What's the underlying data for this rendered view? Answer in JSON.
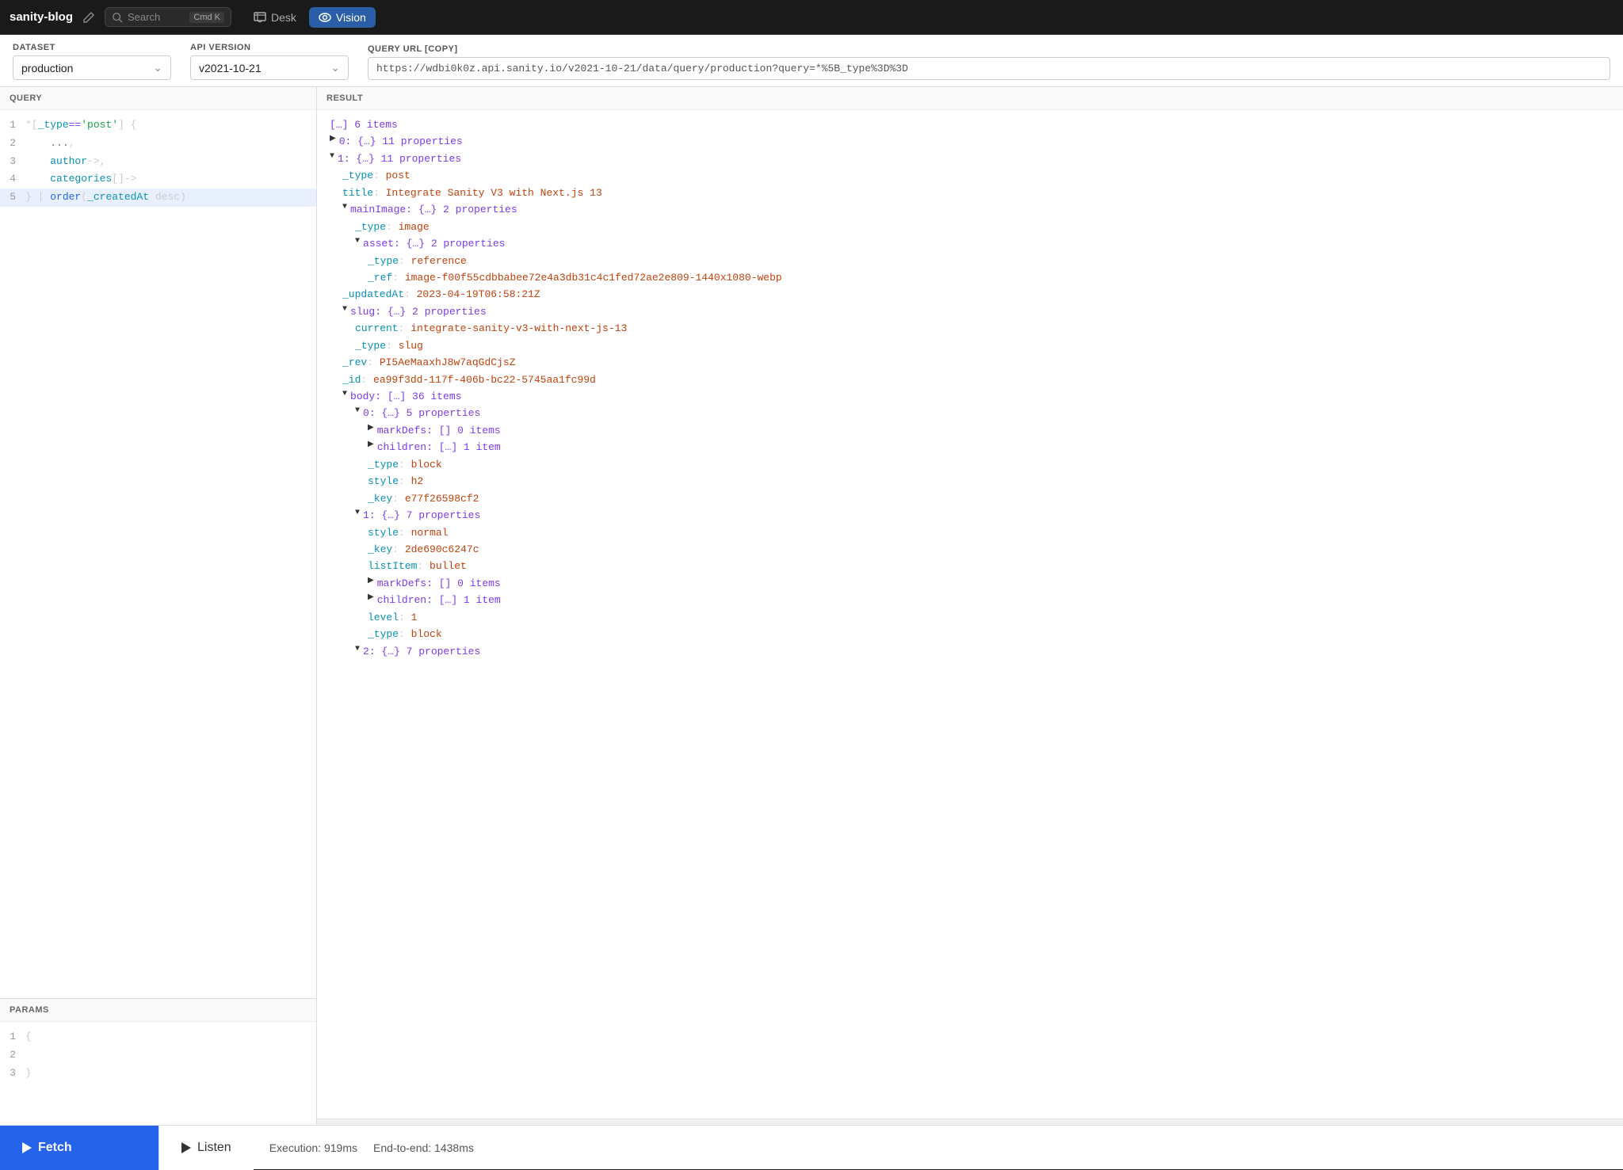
{
  "app": {
    "title": "sanity-blog",
    "search_placeholder": "Search",
    "search_shortcut": "Cmd K"
  },
  "nav": {
    "tabs": [
      {
        "id": "desk",
        "label": "Desk",
        "icon": "desk-icon",
        "active": false
      },
      {
        "id": "vision",
        "label": "Vision",
        "icon": "eye-icon",
        "active": true
      }
    ]
  },
  "controls": {
    "dataset_label": "DATASET",
    "dataset_value": "production",
    "api_version_label": "API VERSION",
    "api_version_value": "v2021-10-21",
    "query_url_label": "QUERY URL [COPY]",
    "query_url_value": "https://wdbi0k0z.api.sanity.io/v2021-10-21/data/query/production?query=*%5B_type%3D%3D"
  },
  "query": {
    "section_label": "QUERY",
    "lines": [
      {
        "num": 1,
        "content": "*[_type=='post'] {"
      },
      {
        "num": 2,
        "content": "    ...,"
      },
      {
        "num": 3,
        "content": "    author->,"
      },
      {
        "num": 4,
        "content": "    categories[]->"
      },
      {
        "num": 5,
        "content": "} | order(_createdAt desc)"
      }
    ]
  },
  "params": {
    "section_label": "PARAMS",
    "lines": [
      {
        "num": 1,
        "content": "{"
      },
      {
        "num": 2,
        "content": ""
      },
      {
        "num": 3,
        "content": "}"
      }
    ]
  },
  "result": {
    "section_label": "RESULT",
    "items": [
      {
        "indent": 0,
        "triangle": "",
        "text": "[…] 6 items",
        "color": "purple"
      },
      {
        "indent": 0,
        "triangle": "▶",
        "text": "0: {…} 11 properties",
        "color": "purple"
      },
      {
        "indent": 0,
        "triangle": "▼",
        "text": "1: {…} 11 properties",
        "color": "purple"
      },
      {
        "indent": 1,
        "triangle": "",
        "text": "_type: post",
        "color": "normal"
      },
      {
        "indent": 1,
        "triangle": "",
        "text": "title: Integrate Sanity V3 with Next.js 13",
        "color": "normal"
      },
      {
        "indent": 1,
        "triangle": "▼",
        "text": "mainImage: {…} 2 properties",
        "color": "purple"
      },
      {
        "indent": 2,
        "triangle": "",
        "text": "_type: image",
        "color": "normal"
      },
      {
        "indent": 2,
        "triangle": "▼",
        "text": "asset: {…} 2 properties",
        "color": "purple"
      },
      {
        "indent": 3,
        "triangle": "",
        "text": "_type: reference",
        "color": "normal"
      },
      {
        "indent": 3,
        "triangle": "",
        "text": "_ref: image-f00f55cdbbabee72e4a3db31c4c1fed72ae2e809-1440x1080-webp",
        "color": "normal"
      },
      {
        "indent": 1,
        "triangle": "",
        "text": "_updatedAt: 2023-04-19T06:58:21Z",
        "color": "normal"
      },
      {
        "indent": 1,
        "triangle": "▼",
        "text": "slug: {…} 2 properties",
        "color": "purple"
      },
      {
        "indent": 2,
        "triangle": "",
        "text": "current: integrate-sanity-v3-with-next-js-13",
        "color": "normal"
      },
      {
        "indent": 2,
        "triangle": "",
        "text": "_type: slug",
        "color": "normal"
      },
      {
        "indent": 1,
        "triangle": "",
        "text": "_rev: PI5AeMaaxhJ8w7aqGdCjsZ",
        "color": "normal"
      },
      {
        "indent": 1,
        "triangle": "",
        "text": "_id: ea99f3dd-117f-406b-bc22-5745aa1fc99d",
        "color": "normal"
      },
      {
        "indent": 1,
        "triangle": "▼",
        "text": "body: […] 36 items",
        "color": "purple"
      },
      {
        "indent": 2,
        "triangle": "▼",
        "text": "0: {…} 5 properties",
        "color": "purple"
      },
      {
        "indent": 3,
        "triangle": "▶",
        "text": "markDefs: [] 0 items",
        "color": "purple"
      },
      {
        "indent": 3,
        "triangle": "▶",
        "text": "children: […] 1 item",
        "color": "purple"
      },
      {
        "indent": 3,
        "triangle": "",
        "text": "_type: block",
        "color": "normal"
      },
      {
        "indent": 3,
        "triangle": "",
        "text": "style: h2",
        "color": "normal"
      },
      {
        "indent": 3,
        "triangle": "",
        "text": "_key: e77f26598cf2",
        "color": "normal"
      },
      {
        "indent": 2,
        "triangle": "▼",
        "text": "1: {…} 7 properties",
        "color": "purple"
      },
      {
        "indent": 3,
        "triangle": "",
        "text": "style: normal",
        "color": "normal"
      },
      {
        "indent": 3,
        "triangle": "",
        "text": "_key: 2de690c6247c",
        "color": "normal"
      },
      {
        "indent": 3,
        "triangle": "",
        "text": "listItem: bullet",
        "color": "normal"
      },
      {
        "indent": 3,
        "triangle": "▶",
        "text": "markDefs: [] 0 items",
        "color": "purple"
      },
      {
        "indent": 3,
        "triangle": "▶",
        "text": "children: […] 1 item",
        "color": "purple"
      },
      {
        "indent": 3,
        "triangle": "",
        "text": "level: 1",
        "color": "normal"
      },
      {
        "indent": 3,
        "triangle": "",
        "text": "_type: block",
        "color": "normal"
      },
      {
        "indent": 2,
        "triangle": "▼",
        "text": "2: {…} 7 properties",
        "color": "purple"
      }
    ]
  },
  "bottom_bar": {
    "fetch_label": "Fetch",
    "listen_label": "Listen",
    "execution_label": "Execution: 919ms",
    "end_to_end_label": "End-to-end: 1438ms"
  }
}
